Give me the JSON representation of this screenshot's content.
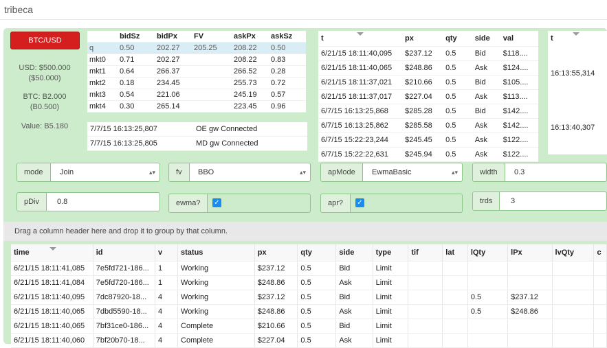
{
  "app": {
    "title": "tribeca"
  },
  "pair": {
    "label": "BTC/USD"
  },
  "balances": {
    "usd": "USD: $500.000",
    "usd_held": "($50.000)",
    "btc": "BTC: B2.000",
    "btc_held": "(B0.500)",
    "value": "Value: B5.180"
  },
  "quotes": {
    "headers": [
      "",
      "bidSz",
      "bidPx",
      "FV",
      "askPx",
      "askSz"
    ],
    "rows": [
      [
        "q",
        "0.50",
        "202.27",
        "205.25",
        "208.22",
        "0.50"
      ],
      [
        "mkt0",
        "0.71",
        "202.27",
        "",
        "208.22",
        "0.83"
      ],
      [
        "mkt1",
        "0.64",
        "266.37",
        "",
        "266.52",
        "0.28"
      ],
      [
        "mkt2",
        "0.18",
        "234.45",
        "",
        "255.73",
        "0.72"
      ],
      [
        "mkt3",
        "0.54",
        "221.06",
        "",
        "245.19",
        "0.57"
      ],
      [
        "mkt4",
        "0.30",
        "265.14",
        "",
        "223.45",
        "0.96"
      ]
    ]
  },
  "messages": [
    {
      "time": "7/7/15 16:13:25,807",
      "text": "OE gw Connected"
    },
    {
      "time": "7/7/15 16:13:25,805",
      "text": "MD gw Connected"
    }
  ],
  "trades": {
    "headers": [
      "t",
      "px",
      "qty",
      "side",
      "val"
    ],
    "rows": [
      [
        "6/21/15 18:11:40,095",
        "$237.12",
        "0.5",
        "Bid",
        "$118...."
      ],
      [
        "6/21/15 18:11:40,065",
        "$248.86",
        "0.5",
        "Ask",
        "$124...."
      ],
      [
        "6/21/15 18:11:37,021",
        "$210.66",
        "0.5",
        "Bid",
        "$105...."
      ],
      [
        "6/21/15 18:11:37,017",
        "$227.04",
        "0.5",
        "Ask",
        "$113...."
      ],
      [
        "6/7/15 16:13:25,868",
        "$285.28",
        "0.5",
        "Bid",
        "$142...."
      ],
      [
        "6/7/15 16:13:25,862",
        "$285.58",
        "0.5",
        "Ask",
        "$142...."
      ],
      [
        "6/7/15 15:22:23,244",
        "$245.45",
        "0.5",
        "Ask",
        "$122...."
      ],
      [
        "6/7/15 15:22:22,631",
        "$245.94",
        "0.5",
        "Ask",
        "$122...."
      ]
    ]
  },
  "fvtimes": {
    "header": "t",
    "rows": [
      "16:13:55,314",
      "16:13:40,307"
    ]
  },
  "controls": {
    "mode": {
      "label": "mode",
      "value": "Join"
    },
    "fv": {
      "label": "fv",
      "value": "BBO"
    },
    "apMode": {
      "label": "apMode",
      "value": "EwmaBasic"
    },
    "width": {
      "label": "width",
      "value": "0.3"
    },
    "pDiv": {
      "label": "pDiv",
      "value": "0.8"
    },
    "ewma": {
      "label": "ewma?",
      "checked": true
    },
    "apr": {
      "label": "apr?",
      "checked": true
    },
    "trds": {
      "label": "trds",
      "value": "3"
    },
    "check_glyph": "✓",
    "select_arrow": "▴▾"
  },
  "grid": {
    "group_hint": "Drag a column header here and drop it to group by that column.",
    "headers": [
      "time",
      "id",
      "v",
      "status",
      "px",
      "qty",
      "side",
      "type",
      "tif",
      "lat",
      "lQty",
      "lPx",
      "lvQty",
      "c"
    ],
    "rows": [
      [
        "6/21/15 18:11:41,085",
        "7e5fd721-186...",
        "1",
        "Working",
        "$237.12",
        "0.5",
        "Bid",
        "Limit",
        "",
        "",
        "",
        "",
        "",
        ""
      ],
      [
        "6/21/15 18:11:41,084",
        "7e5fd720-186...",
        "1",
        "Working",
        "$248.86",
        "0.5",
        "Ask",
        "Limit",
        "",
        "",
        "",
        "",
        "",
        ""
      ],
      [
        "6/21/15 18:11:40,095",
        "7dc87920-18...",
        "4",
        "Working",
        "$237.12",
        "0.5",
        "Bid",
        "Limit",
        "",
        "",
        "0.5",
        "$237.12",
        "",
        ""
      ],
      [
        "6/21/15 18:11:40,065",
        "7dbd5590-18...",
        "4",
        "Working",
        "$248.86",
        "0.5",
        "Ask",
        "Limit",
        "",
        "",
        "0.5",
        "$248.86",
        "",
        ""
      ],
      [
        "6/21/15 18:11:40,065",
        "7bf31ce0-186...",
        "4",
        "Complete",
        "$210.66",
        "0.5",
        "Bid",
        "Limit",
        "",
        "",
        "",
        "",
        "",
        ""
      ],
      [
        "6/21/15 18:11:40,060",
        "7bf20b70-18...",
        "4",
        "Complete",
        "$227.04",
        "0.5",
        "Ask",
        "Limit",
        "",
        "",
        "",
        "",
        "",
        ""
      ]
    ]
  }
}
